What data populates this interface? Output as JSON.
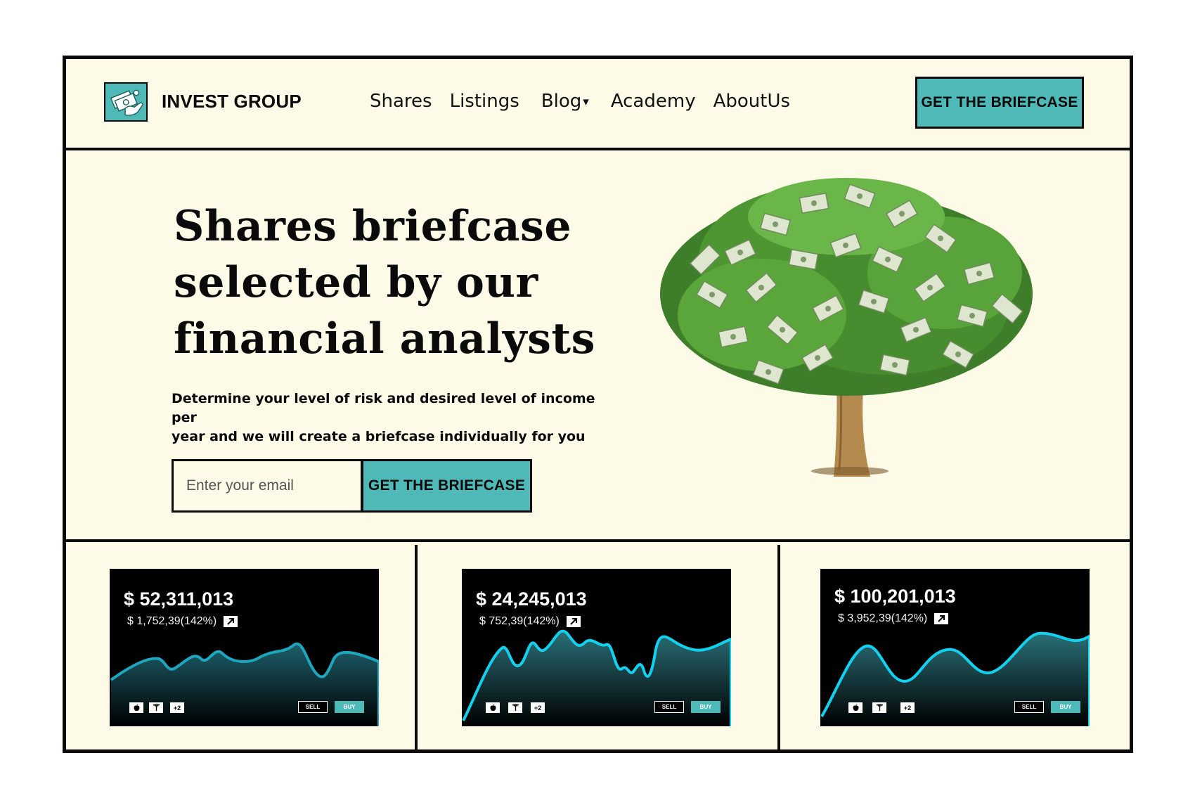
{
  "brand": {
    "name": "INVEST GROUP",
    "logo_icon": "money-stack-icon"
  },
  "nav": {
    "items": [
      {
        "label": "Shares"
      },
      {
        "label": "Listings"
      },
      {
        "label": "Blog"
      },
      {
        "label": "Academy"
      },
      {
        "label": "AboutUs"
      }
    ],
    "blog_caret": "▾"
  },
  "header": {
    "cta_label": "GET THE BRIEFCASE"
  },
  "hero": {
    "title_lines": [
      "Shares briefcase",
      "selected by our",
      "financial analysts"
    ],
    "subtitle_lines": [
      "Determine your level of risk and desired level of income per",
      "year and we will create a briefcase individually for you"
    ],
    "email_placeholder": "Enter your email",
    "cta_label": "GET THE BRIEFCASE",
    "image": "money-tree"
  },
  "cards": [
    {
      "price": "$ 52,311,013",
      "change": "$ 1,752,39(142%)",
      "tags": [
        "apple",
        "tesla",
        "+2"
      ],
      "sell": "SELL",
      "buy": "BUY",
      "line_color": "#1da7be"
    },
    {
      "price": "$ 24,245,013",
      "change": "$ 752,39(142%)",
      "tags": [
        "apple",
        "tesla",
        "+2"
      ],
      "sell": "SELL",
      "buy": "BUY",
      "line_color": "#12d1ef"
    },
    {
      "price": "$ 100,201,013",
      "change": "$ 3,952,39(142%)",
      "tags": [
        "apple",
        "tesla",
        "+2"
      ],
      "sell": "SELL",
      "buy": "BUY",
      "line_color": "#12d1ef"
    }
  ],
  "colors": {
    "accent": "#4fb9b7",
    "background": "#fdfbe8",
    "ink": "#0a0a0a",
    "card": "#000000"
  }
}
